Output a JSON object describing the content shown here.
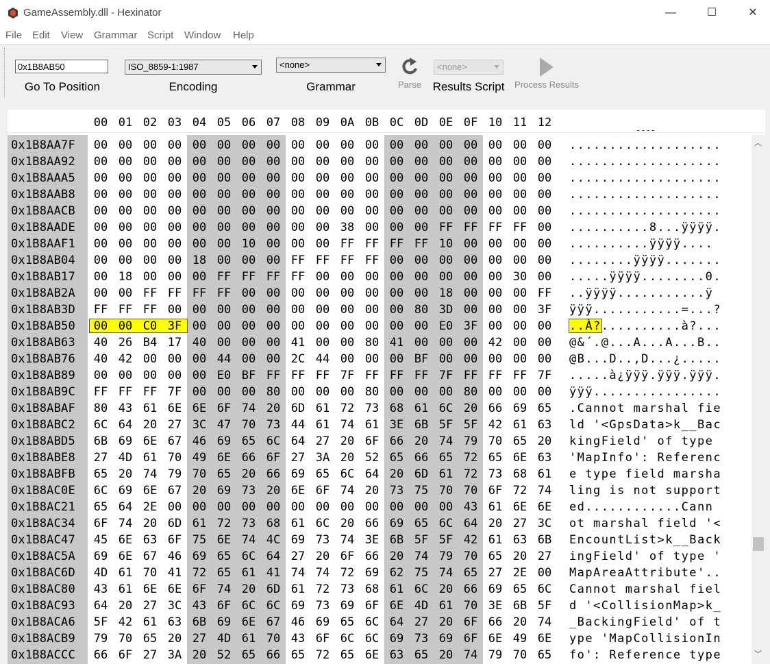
{
  "window": {
    "title": "GameAssembly.dll - Hexinator",
    "minimize_glyph": "—",
    "maximize_glyph": "☐",
    "close_glyph": "✕"
  },
  "menu": [
    "File",
    "Edit",
    "View",
    "Grammar",
    "Script",
    "Window",
    "Help"
  ],
  "toolbar": {
    "goto_value": "0x1B8AB50",
    "goto_label": "Go To Position",
    "encoding_value": "ISO_8859-1:1987",
    "encoding_label": "Encoding",
    "grammar_value": "<none>",
    "grammar_label": "Grammar",
    "parse_label": "Parse",
    "results_value": "<none>",
    "results_label": "Results Script",
    "process_label": "Process Results"
  },
  "hex": {
    "columns": [
      "00",
      "01",
      "02",
      "03",
      "04",
      "05",
      "06",
      "07",
      "08",
      "09",
      "0A",
      "0B",
      "0C",
      "0D",
      "0E",
      "0F",
      "10",
      "11",
      "12"
    ],
    "top_ascii_fragment": "----",
    "rows": [
      {
        "addr": "0x1B8AA7F",
        "bytes": "00 00 00 00 00 00 00 00 00 00 00 00 00 00 00 00 00 00 00",
        "ascii": "..................."
      },
      {
        "addr": "0x1B8AA92",
        "bytes": "00 00 00 00 00 00 00 00 00 00 00 00 00 00 00 00 00 00 00",
        "ascii": "..................."
      },
      {
        "addr": "0x1B8AAA5",
        "bytes": "00 00 00 00 00 00 00 00 00 00 00 00 00 00 00 00 00 00 00",
        "ascii": "..................."
      },
      {
        "addr": "0x1B8AAB8",
        "bytes": "00 00 00 00 00 00 00 00 00 00 00 00 00 00 00 00 00 00 00",
        "ascii": "..................."
      },
      {
        "addr": "0x1B8AACB",
        "bytes": "00 00 00 00 00 00 00 00 00 00 00 00 00 00 00 00 00 00 00",
        "ascii": "..................."
      },
      {
        "addr": "0x1B8AADE",
        "bytes": "00 00 00 00 00 00 00 00 00 00 38 00 00 00 FF FF FF FF 00",
        "ascii": "..........8...ÿÿÿÿ."
      },
      {
        "addr": "0x1B8AAF1",
        "bytes": "00 00 00 00 00 00 10 00 00 00 FF FF FF FF 10 00 00 00 00",
        "ascii": "..........ÿÿÿÿ...."
      },
      {
        "addr": "0x1B8AB04",
        "bytes": "00 00 00 00 18 00 00 00 FF FF FF FF 00 00 00 00 00 00 00",
        "ascii": "........ÿÿÿÿ......."
      },
      {
        "addr": "0x1B8AB17",
        "bytes": "00 18 00 00 00 FF FF FF FF 00 00 00 00 00 00 00 00 30 00",
        "ascii": ".....ÿÿÿÿ........0."
      },
      {
        "addr": "0x1B8AB2A",
        "bytes": "00 00 FF FF FF FF 00 00 00 00 00 00 00 00 18 00 00 00 FF",
        "ascii": "..ÿÿÿÿ...........ÿ"
      },
      {
        "addr": "0x1B8AB3D",
        "bytes": "FF FF FF 00 00 00 00 00 00 00 00 00 00 80 3D 00 00 00 3F",
        "ascii": "ÿÿÿ...........=...?"
      },
      {
        "addr": "0x1B8AB50",
        "bytes": "00 00 C0 3F 00 00 00 00 00 00 00 00 00 00 E0 3F 00 00 00",
        "ascii": "..À?..........à?..."
      },
      {
        "addr": "0x1B8AB63",
        "bytes": "40 26 B4 17 40 00 00 00 41 00 00 80 41 00 00 00 42 00 00",
        "ascii": "@&´.@...A...A...B.."
      },
      {
        "addr": "0x1B8AB76",
        "bytes": "40 42 00 00 00 44 00 00 2C 44 00 00 00 BF 00 00 00 00 00",
        "ascii": "@B...D..,D...¿....."
      },
      {
        "addr": "0x1B8AB89",
        "bytes": "00 00 00 00 00 E0 BF FF FF FF 7F FF FF FF 7F FF FF FF 7F",
        "ascii": ".....à¿ÿÿÿ.ÿÿÿ.ÿÿÿ."
      },
      {
        "addr": "0x1B8AB9C",
        "bytes": "FF FF FF 7F 00 00 00 80 00 00 00 80 00 00 00 80 00 00 00",
        "ascii": "ÿÿÿ................"
      },
      {
        "addr": "0x1B8ABAF",
        "bytes": "80 43 61 6E 6E 6F 74 20 6D 61 72 73 68 61 6C 20 66 69 65",
        "ascii": ".Cannot marshal fie"
      },
      {
        "addr": "0x1B8ABC2",
        "bytes": "6C 64 20 27 3C 47 70 73 44 61 74 61 3E 6B 5F 5F 42 61 63",
        "ascii": "ld '<GpsData>k__Bac"
      },
      {
        "addr": "0x1B8ABD5",
        "bytes": "6B 69 6E 67 46 69 65 6C 64 27 20 6F 66 20 74 79 70 65 20",
        "ascii": "kingField' of type "
      },
      {
        "addr": "0x1B8ABE8",
        "bytes": "27 4D 61 70 49 6E 66 6F 27 3A 20 52 65 66 65 72 65 6E 63",
        "ascii": "'MapInfo': Referenc"
      },
      {
        "addr": "0x1B8ABFB",
        "bytes": "65 20 74 79 70 65 20 66 69 65 6C 64 20 6D 61 72 73 68 61",
        "ascii": "e type field marsha"
      },
      {
        "addr": "0x1B8AC0E",
        "bytes": "6C 69 6E 67 20 69 73 20 6E 6F 74 20 73 75 70 70 6F 72 74",
        "ascii": "ling is not support"
      },
      {
        "addr": "0x1B8AC21",
        "bytes": "65 64 2E 00 00 00 00 00 00 00 00 00 00 00 00 43 61 6E 6E",
        "ascii": "ed............Cann"
      },
      {
        "addr": "0x1B8AC34",
        "bytes": "6F 74 20 6D 61 72 73 68 61 6C 20 66 69 65 6C 64 20 27 3C",
        "ascii": "ot marshal field '<"
      },
      {
        "addr": "0x1B8AC47",
        "bytes": "45 6E 63 6F 75 6E 74 4C 69 73 74 3E 6B 5F 5F 42 61 63 6B",
        "ascii": "EncountList>k__Back"
      },
      {
        "addr": "0x1B8AC5A",
        "bytes": "69 6E 67 46 69 65 6C 64 27 20 6F 66 20 74 79 70 65 20 27",
        "ascii": "ingField' of type '"
      },
      {
        "addr": "0x1B8AC6D",
        "bytes": "4D 61 70 41 72 65 61 41 74 74 72 69 62 75 74 65 27 2E 00",
        "ascii": "MapAreaAttribute'.."
      },
      {
        "addr": "0x1B8AC80",
        "bytes": "43 61 6E 6E 6F 74 20 6D 61 72 73 68 61 6C 20 66 69 65 6C",
        "ascii": "Cannot marshal fiel"
      },
      {
        "addr": "0x1B8AC93",
        "bytes": "64 20 27 3C 43 6F 6C 6C 69 73 69 6F 6E 4D 61 70 3E 6B 5F",
        "ascii": "d '<CollisionMap>k_"
      },
      {
        "addr": "0x1B8ACA6",
        "bytes": "5F 42 61 63 6B 69 6E 67 46 69 65 6C 64 27 20 6F 66 20 74",
        "ascii": "_BackingField' of t"
      },
      {
        "addr": "0x1B8ACB9",
        "bytes": "79 70 65 20 27 4D 61 70 43 6F 6C 6C 69 73 69 6F 6E 49 6E",
        "ascii": "ype 'MapCollisionIn"
      },
      {
        "addr": "0x1B8ACCC",
        "bytes": "66 6F 27 3A 20 52 65 66 65 72 65 6E 63 65 20 74 79 70 65",
        "ascii": "fo': Reference type"
      }
    ]
  }
}
